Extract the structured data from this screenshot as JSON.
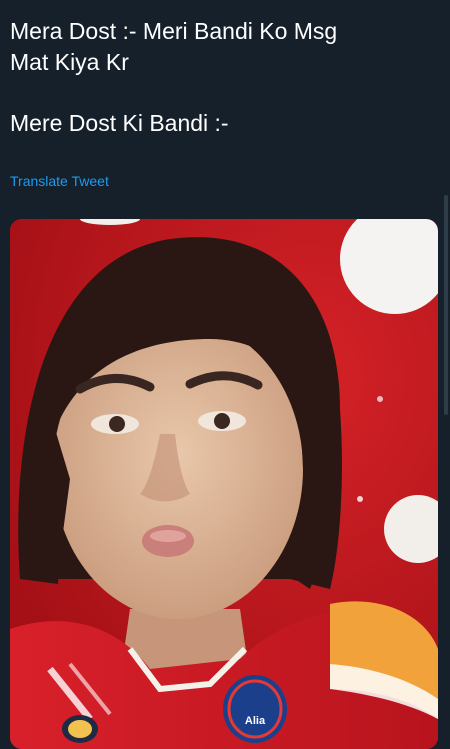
{
  "tweet": {
    "lines": [
      "Mera Dost :- Meri Bandi Ko Msg",
      "Mat Kiya Kr",
      "Mere Dost Ki Bandi :-"
    ],
    "translate_label": "Translate Tweet"
  },
  "media": {
    "jersey_text": "Alia",
    "colors": {
      "background": "#15202b",
      "link": "#1d9bf0",
      "photo_red": "#c4161c",
      "jersey_orange": "#f2a23a"
    }
  }
}
